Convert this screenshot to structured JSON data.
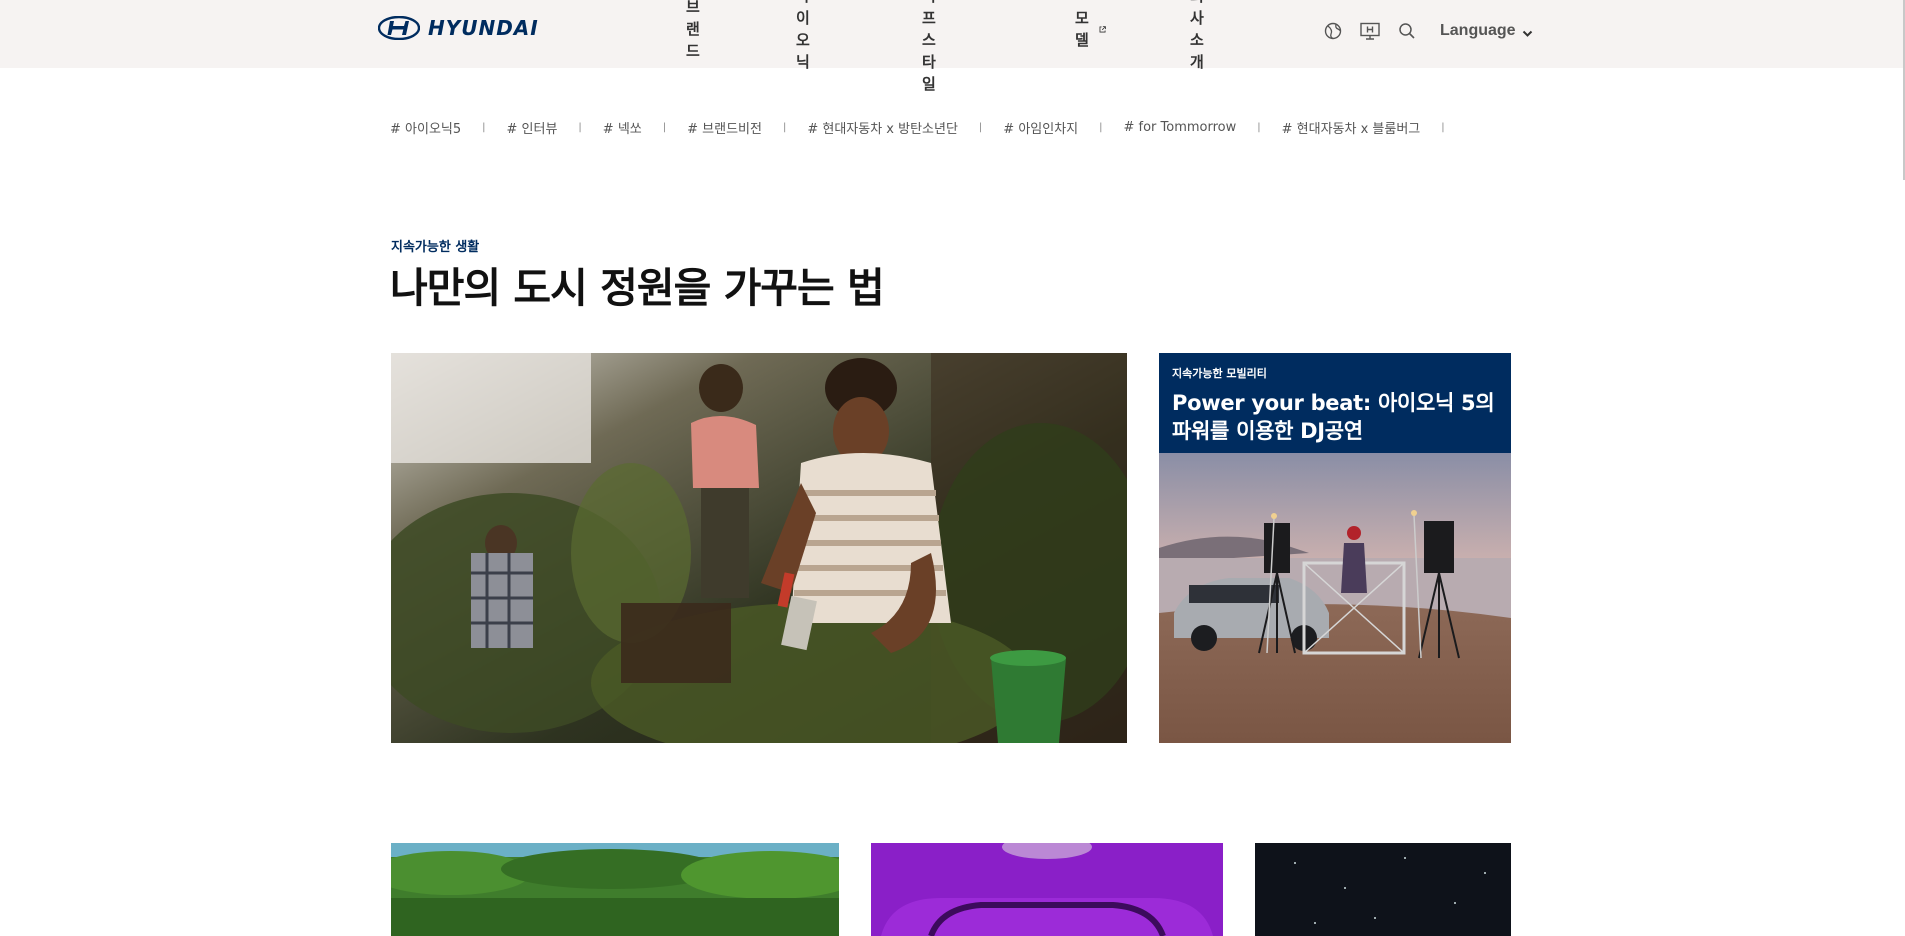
{
  "header": {
    "logo_text": "HYUNDAI",
    "nav": [
      {
        "label": "브랜드"
      },
      {
        "label": "아이오닉"
      },
      {
        "label": "라이프스타일"
      },
      {
        "label": "모델"
      },
      {
        "label": "회사소개"
      }
    ],
    "utility_icons": [
      "globe-icon",
      "monitor-h-icon",
      "search-icon"
    ],
    "language_label": "Language"
  },
  "tags": [
    "# 아이오닉5",
    "# 인터뷰",
    "# 넥쏘",
    "# 브랜드비전",
    "# 현대자동차 x 방탄소년단",
    "# 아임인차지",
    "# for Tommorrow",
    "# 현대자동차 x 블룸버그"
  ],
  "tag_separator": "|",
  "feature": {
    "category": "지속가능한 생활",
    "title": "나만의 도시 정원을 가꾸는 법"
  },
  "side_card": {
    "category": "지속가능한 모빌리티",
    "title_line1": "Power your beat: 아이오닉 5의",
    "title_line2": "파워를 이용한 DJ공연"
  },
  "colors": {
    "brand_navy": "#002c5f",
    "header_bg": "#f6f3f2"
  }
}
